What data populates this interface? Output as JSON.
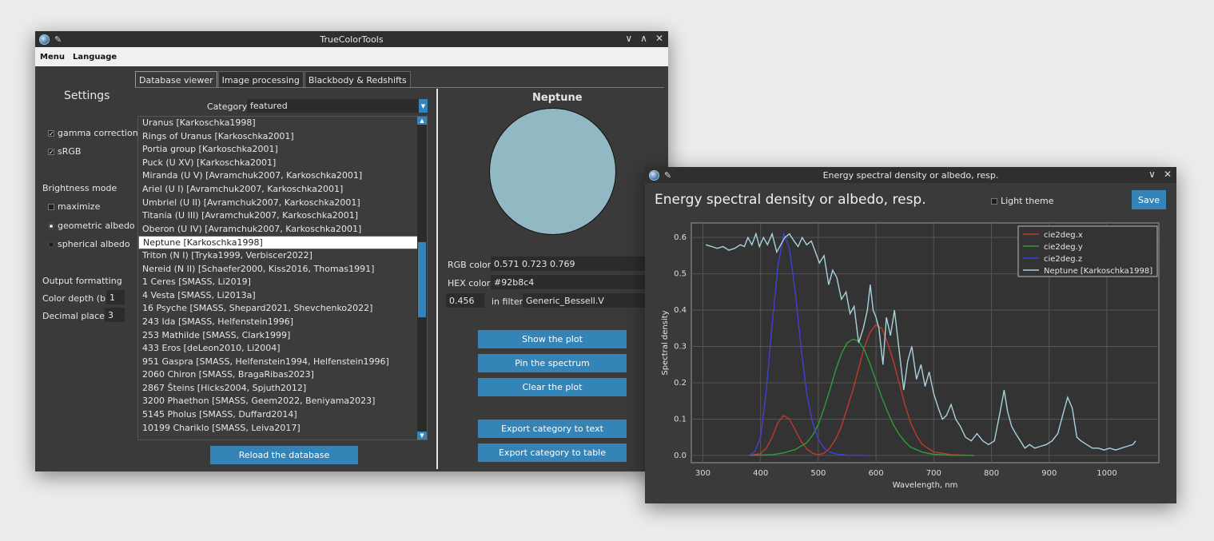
{
  "main_window": {
    "title": "TrueColorTools",
    "menu": [
      "Menu",
      "Language"
    ],
    "settings_title": "Settings",
    "gamma_correction": "gamma correction",
    "srgb": "sRGB",
    "brightness_mode_label": "Brightness mode",
    "maximize": "maximize",
    "geometric_albedo": "geometric albedo",
    "spherical_albedo": "spherical albedo",
    "output_formatting_label": "Output formatting",
    "color_depth_label": "Color depth (bit)",
    "color_depth_value": "1",
    "decimal_places_label": "Decimal places",
    "decimal_places_value": "3",
    "tabs": [
      "Database viewer",
      "Image processing",
      "Blackbody & Redshifts"
    ],
    "category_label": "Category",
    "category_value": "featured",
    "objects": [
      "Uranus [Karkoschka1998]",
      "Rings of Uranus [Karkoschka2001]",
      "Portia group [Karkoschka2001]",
      "Puck (U XV) [Karkoschka2001]",
      "Miranda (U V) [Avramchuk2007, Karkoschka2001]",
      "Ariel (U I) [Avramchuk2007, Karkoschka2001]",
      "Umbriel (U II) [Avramchuk2007, Karkoschka2001]",
      "Titania (U III) [Avramchuk2007, Karkoschka2001]",
      "Oberon (U IV) [Avramchuk2007, Karkoschka2001]",
      "Neptune [Karkoschka1998]",
      "Triton (N I) [Tryka1999, Verbiscer2022]",
      "Nereid (N II) [Schaefer2000, Kiss2016, Thomas1991]",
      "1 Ceres [SMASS, Li2019]",
      "4 Vesta [SMASS, Li2013a]",
      "16 Psyche [SMASS, Shepard2021, Shevchenko2022]",
      "243 Ida [SMASS, Helfenstein1996]",
      "253 Mathilde [SMASS, Clark1999]",
      "433 Eros [deLeon2010, Li2004]",
      "951 Gaspra [SMASS, Helfenstein1994, Helfenstein1996]",
      "2060 Chiron [SMASS, BragaRibas2023]",
      "2867 Šteins [Hicks2004, Spjuth2012]",
      "3200 Phaethon [SMASS, Geem2022, Beniyama2023]",
      "5145 Pholus [SMASS, Duffard2014]",
      "10199 Chariklo [SMASS, Leiva2017]"
    ],
    "selected_index": 9,
    "reload_button": "Reload the database",
    "object_name": "Neptune",
    "swatch_color": "#92b8c4",
    "rgb_label": "RGB color",
    "rgb_value": "0.571 0.723 0.769",
    "hex_label": "HEX color",
    "hex_value": "#92b8c4",
    "filter_value": "0.456",
    "in_filter_label": "in filter",
    "filter_name": "Generic_Bessell.V",
    "show_plot": "Show the plot",
    "pin_spectrum": "Pin the spectrum",
    "clear_plot": "Clear the plot",
    "export_text": "Export category to text",
    "export_table": "Export category to table"
  },
  "plot_window": {
    "title": "Energy spectral density or albedo, resp.",
    "heading": "Energy spectral density or albedo, resp.",
    "light_theme": "Light theme",
    "save": "Save"
  },
  "chart_data": {
    "type": "line",
    "xlabel": "Wavelength, nm",
    "ylabel": "Spectral density",
    "xlim": [
      280,
      1090
    ],
    "ylim": [
      -0.02,
      0.64
    ],
    "xticks": [
      300,
      400,
      500,
      600,
      700,
      800,
      900,
      1000
    ],
    "yticks": [
      0.0,
      0.1,
      0.2,
      0.3,
      0.4,
      0.5,
      0.6
    ],
    "grid": true,
    "legend": "top-right",
    "series": [
      {
        "name": "cie2deg.x",
        "color": "#c0392b",
        "x": [
          380,
          400,
          410,
          420,
          430,
          440,
          450,
          460,
          470,
          480,
          490,
          500,
          510,
          520,
          530,
          540,
          550,
          560,
          570,
          580,
          590,
          600,
          610,
          620,
          630,
          640,
          650,
          660,
          670,
          680,
          700,
          730,
          770
        ],
        "y": [
          0.0,
          0.005,
          0.02,
          0.05,
          0.09,
          0.11,
          0.1,
          0.07,
          0.04,
          0.018,
          0.006,
          0.002,
          0.006,
          0.02,
          0.045,
          0.08,
          0.13,
          0.18,
          0.24,
          0.3,
          0.34,
          0.36,
          0.35,
          0.31,
          0.26,
          0.2,
          0.14,
          0.09,
          0.055,
          0.03,
          0.01,
          0.002,
          0.0
        ]
      },
      {
        "name": "cie2deg.y",
        "color": "#2e9c3a",
        "x": [
          380,
          420,
          440,
          460,
          480,
          490,
          500,
          510,
          520,
          530,
          540,
          550,
          560,
          570,
          580,
          590,
          600,
          610,
          620,
          630,
          640,
          650,
          660,
          680,
          700,
          730,
          770
        ],
        "y": [
          0.0,
          0.002,
          0.007,
          0.016,
          0.035,
          0.055,
          0.085,
          0.13,
          0.18,
          0.235,
          0.28,
          0.31,
          0.32,
          0.315,
          0.29,
          0.25,
          0.205,
          0.16,
          0.12,
          0.085,
          0.058,
          0.038,
          0.023,
          0.009,
          0.003,
          0.0005,
          0.0
        ]
      },
      {
        "name": "cie2deg.z",
        "color": "#4040d8",
        "x": [
          380,
          390,
          400,
          410,
          420,
          430,
          440,
          450,
          460,
          470,
          480,
          490,
          500,
          510,
          520,
          530,
          550,
          590
        ],
        "y": [
          0.0,
          0.01,
          0.05,
          0.18,
          0.36,
          0.52,
          0.61,
          0.57,
          0.45,
          0.3,
          0.17,
          0.09,
          0.045,
          0.02,
          0.009,
          0.004,
          0.001,
          0.0
        ]
      },
      {
        "name": "Neptune [Karkoschka1998]",
        "color": "#a8d3de",
        "x": [
          305,
          315,
          325,
          335,
          345,
          355,
          365,
          372,
          378,
          385,
          392,
          398,
          405,
          412,
          420,
          428,
          435,
          442,
          450,
          458,
          465,
          472,
          480,
          488,
          495,
          502,
          510,
          518,
          525,
          532,
          540,
          548,
          555,
          562,
          570,
          578,
          585,
          590,
          595,
          600,
          605,
          612,
          618,
          625,
          632,
          640,
          648,
          655,
          662,
          670,
          678,
          685,
          692,
          700,
          708,
          715,
          722,
          730,
          738,
          746,
          755,
          765,
          775,
          785,
          795,
          805,
          815,
          822,
          828,
          835,
          842,
          850,
          858,
          866,
          875,
          885,
          895,
          905,
          915,
          925,
          932,
          940,
          948,
          955,
          965,
          975,
          985,
          995,
          1005,
          1015,
          1025,
          1035,
          1045,
          1050
        ],
        "y": [
          0.58,
          0.575,
          0.57,
          0.575,
          0.565,
          0.57,
          0.58,
          0.575,
          0.6,
          0.58,
          0.61,
          0.575,
          0.6,
          0.58,
          0.61,
          0.56,
          0.58,
          0.6,
          0.61,
          0.59,
          0.575,
          0.6,
          0.58,
          0.59,
          0.56,
          0.53,
          0.55,
          0.47,
          0.51,
          0.49,
          0.43,
          0.45,
          0.39,
          0.41,
          0.31,
          0.35,
          0.4,
          0.47,
          0.4,
          0.38,
          0.35,
          0.25,
          0.38,
          0.33,
          0.4,
          0.29,
          0.18,
          0.26,
          0.3,
          0.21,
          0.25,
          0.19,
          0.23,
          0.17,
          0.13,
          0.1,
          0.11,
          0.14,
          0.1,
          0.08,
          0.05,
          0.04,
          0.06,
          0.04,
          0.03,
          0.04,
          0.12,
          0.18,
          0.12,
          0.08,
          0.06,
          0.04,
          0.02,
          0.03,
          0.02,
          0.025,
          0.03,
          0.04,
          0.06,
          0.12,
          0.16,
          0.13,
          0.05,
          0.04,
          0.03,
          0.02,
          0.02,
          0.015,
          0.02,
          0.015,
          0.02,
          0.025,
          0.03,
          0.04
        ]
      }
    ]
  }
}
